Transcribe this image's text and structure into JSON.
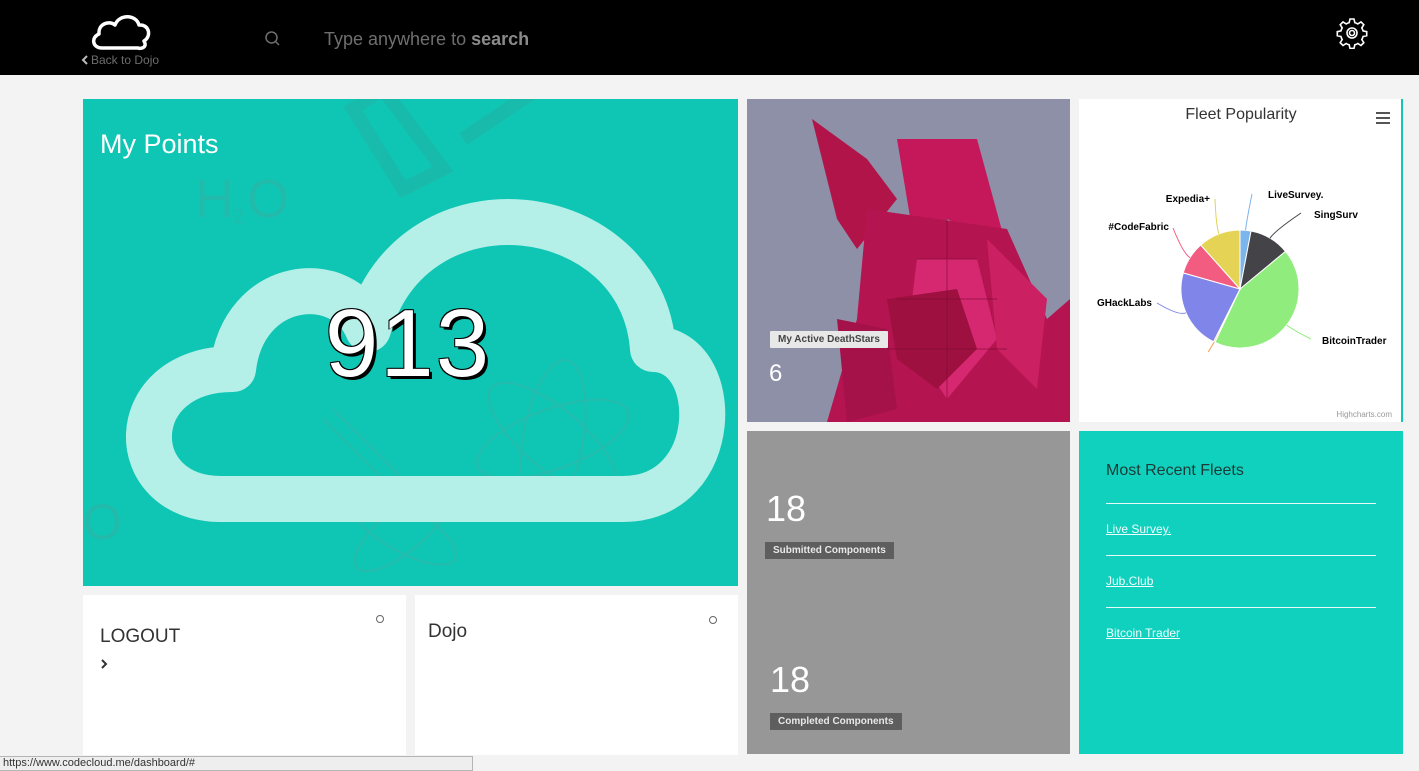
{
  "header": {
    "back_label": "Back to Dojo",
    "search_prefix": "Type anywhere to ",
    "search_bold": "search"
  },
  "points": {
    "title": "My Points",
    "value": "913"
  },
  "deathstars": {
    "label": "My Active DeathStars",
    "count": "6"
  },
  "fleet_chart": {
    "title": "Fleet Popularity",
    "credit": "Highcharts.com"
  },
  "chart_data": {
    "type": "pie",
    "title": "Fleet Popularity",
    "slices": [
      {
        "name": "LiveSurvey.",
        "value": 3,
        "color": "#7cb5ec"
      },
      {
        "name": "SingSurv",
        "value": 11,
        "color": "#434348"
      },
      {
        "name": "BitcoinTrader",
        "value": 43,
        "color": "#90ed7d"
      },
      {
        "name": "",
        "value": 0.4,
        "color": "#f7a35c"
      },
      {
        "name": "GHackLabs",
        "value": 22,
        "color": "#8085e9"
      },
      {
        "name": "#CodeFabric",
        "value": 9,
        "color": "#f15c80"
      },
      {
        "name": "Expedia+",
        "value": 11.6,
        "color": "#e4d354"
      }
    ]
  },
  "components": {
    "submitted_count": "18",
    "submitted_label": "Submitted Components",
    "completed_count": "18",
    "completed_label": "Completed Components"
  },
  "recent_fleets": {
    "title": "Most Recent Fleets",
    "items": [
      "Live Survey.",
      "Jub.Club",
      "Bitcoin Trader"
    ]
  },
  "logout": {
    "label": "LOGOUT"
  },
  "dojo": {
    "label": "Dojo"
  },
  "status_url": "https://www.codecloud.me/dashboard/#",
  "colors": {
    "teal": "#0fc6b4",
    "recent_teal": "#10d1bd",
    "header": "#000000"
  }
}
